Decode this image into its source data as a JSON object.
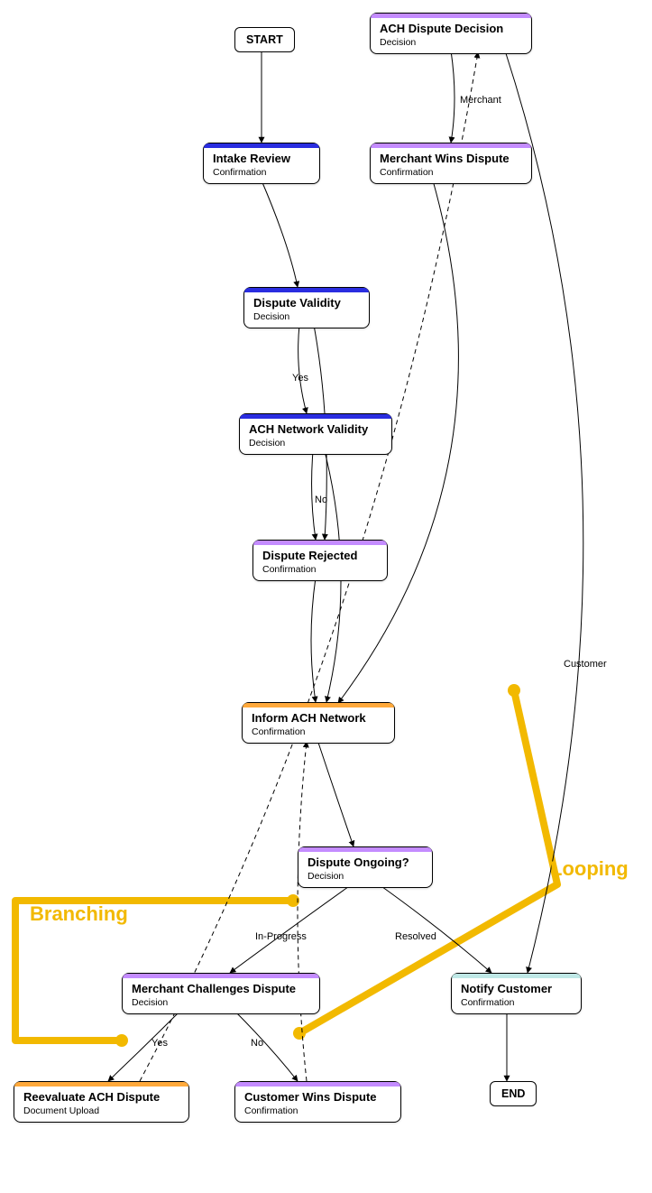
{
  "nodes": {
    "start": {
      "label": "START"
    },
    "intake": {
      "title": "Intake Review",
      "subtitle": "Confirmation",
      "color": "#2a2de0"
    },
    "validity": {
      "title": "Dispute Validity",
      "subtitle": "Decision",
      "color": "#2a2de0"
    },
    "achValidity": {
      "title": "ACH Network Validity",
      "subtitle": "Decision",
      "color": "#2a2de0"
    },
    "rejected": {
      "title": "Dispute Rejected",
      "subtitle": "Confirmation",
      "color": "#c48cff"
    },
    "inform": {
      "title": "Inform ACH Network",
      "subtitle": "Confirmation",
      "color": "#ffa93b"
    },
    "ongoing": {
      "title": "Dispute Ongoing?",
      "subtitle": "Decision",
      "color": "#c48cff"
    },
    "merchChallenges": {
      "title": "Merchant Challenges Dispute",
      "subtitle": "Decision",
      "color": "#c48cff"
    },
    "reeval": {
      "title": "Reevaluate ACH Dispute",
      "subtitle": "Document Upload",
      "color": "#ffa93b"
    },
    "custWins": {
      "title": "Customer Wins Dispute",
      "subtitle": "Confirmation",
      "color": "#c48cff"
    },
    "notify": {
      "title": "Notify Customer",
      "subtitle": "Confirmation",
      "color": "#bfe8e6"
    },
    "end": {
      "label": "END"
    },
    "achDecision": {
      "title": "ACH Dispute Decision",
      "subtitle": "Decision",
      "color": "#c48cff"
    },
    "merchWins": {
      "title": "Merchant Wins Dispute",
      "subtitle": "Confirmation",
      "color": "#c48cff"
    }
  },
  "edgeLabels": {
    "yes1": "Yes",
    "no1": "No",
    "inprog": "In-Progress",
    "resolved": "Resolved",
    "yes2": "Yes",
    "no2": "No",
    "merchant": "Merchant",
    "customer": "Customer"
  },
  "annotations": {
    "branching": "Branching",
    "looping": "Looping"
  },
  "chart_data": {
    "type": "flowchart",
    "nodes": [
      {
        "id": "start",
        "label": "START",
        "kind": "terminal"
      },
      {
        "id": "intake",
        "label": "Intake Review",
        "kind": "Confirmation"
      },
      {
        "id": "validity",
        "label": "Dispute Validity",
        "kind": "Decision"
      },
      {
        "id": "achValidity",
        "label": "ACH Network Validity",
        "kind": "Decision"
      },
      {
        "id": "rejected",
        "label": "Dispute Rejected",
        "kind": "Confirmation"
      },
      {
        "id": "inform",
        "label": "Inform ACH Network",
        "kind": "Confirmation"
      },
      {
        "id": "ongoing",
        "label": "Dispute Ongoing?",
        "kind": "Decision"
      },
      {
        "id": "merchChallenges",
        "label": "Merchant Challenges Dispute",
        "kind": "Decision"
      },
      {
        "id": "reeval",
        "label": "Reevaluate ACH Dispute",
        "kind": "Document Upload"
      },
      {
        "id": "custWins",
        "label": "Customer Wins Dispute",
        "kind": "Confirmation"
      },
      {
        "id": "notify",
        "label": "Notify Customer",
        "kind": "Confirmation"
      },
      {
        "id": "end",
        "label": "END",
        "kind": "terminal"
      },
      {
        "id": "achDecision",
        "label": "ACH Dispute Decision",
        "kind": "Decision"
      },
      {
        "id": "merchWins",
        "label": "Merchant Wins Dispute",
        "kind": "Confirmation"
      }
    ],
    "edges": [
      {
        "from": "start",
        "to": "intake"
      },
      {
        "from": "intake",
        "to": "validity"
      },
      {
        "from": "validity",
        "to": "achValidity",
        "label": "Yes"
      },
      {
        "from": "validity",
        "to": "rejected"
      },
      {
        "from": "achValidity",
        "to": "rejected",
        "label": "No"
      },
      {
        "from": "achValidity",
        "to": "inform"
      },
      {
        "from": "rejected",
        "to": "inform"
      },
      {
        "from": "inform",
        "to": "ongoing"
      },
      {
        "from": "ongoing",
        "to": "merchChallenges",
        "label": "In-Progress"
      },
      {
        "from": "ongoing",
        "to": "notify",
        "label": "Resolved"
      },
      {
        "from": "merchChallenges",
        "to": "reeval",
        "label": "Yes"
      },
      {
        "from": "merchChallenges",
        "to": "custWins",
        "label": "No"
      },
      {
        "from": "reeval",
        "to": "achDecision",
        "style": "dashed"
      },
      {
        "from": "custWins",
        "to": "inform",
        "style": "dashed"
      },
      {
        "from": "notify",
        "to": "end"
      },
      {
        "from": "achDecision",
        "to": "merchWins",
        "label": "Merchant"
      },
      {
        "from": "achDecision",
        "to": "notify",
        "label": "Customer"
      },
      {
        "from": "merchWins",
        "to": "inform"
      }
    ],
    "annotations": [
      {
        "text": "Branching",
        "relates_to": [
          "ongoing",
          "merchChallenges",
          "reeval"
        ]
      },
      {
        "text": "Looping",
        "relates_to": [
          "merchWins",
          "inform",
          "custWins"
        ]
      }
    ]
  }
}
